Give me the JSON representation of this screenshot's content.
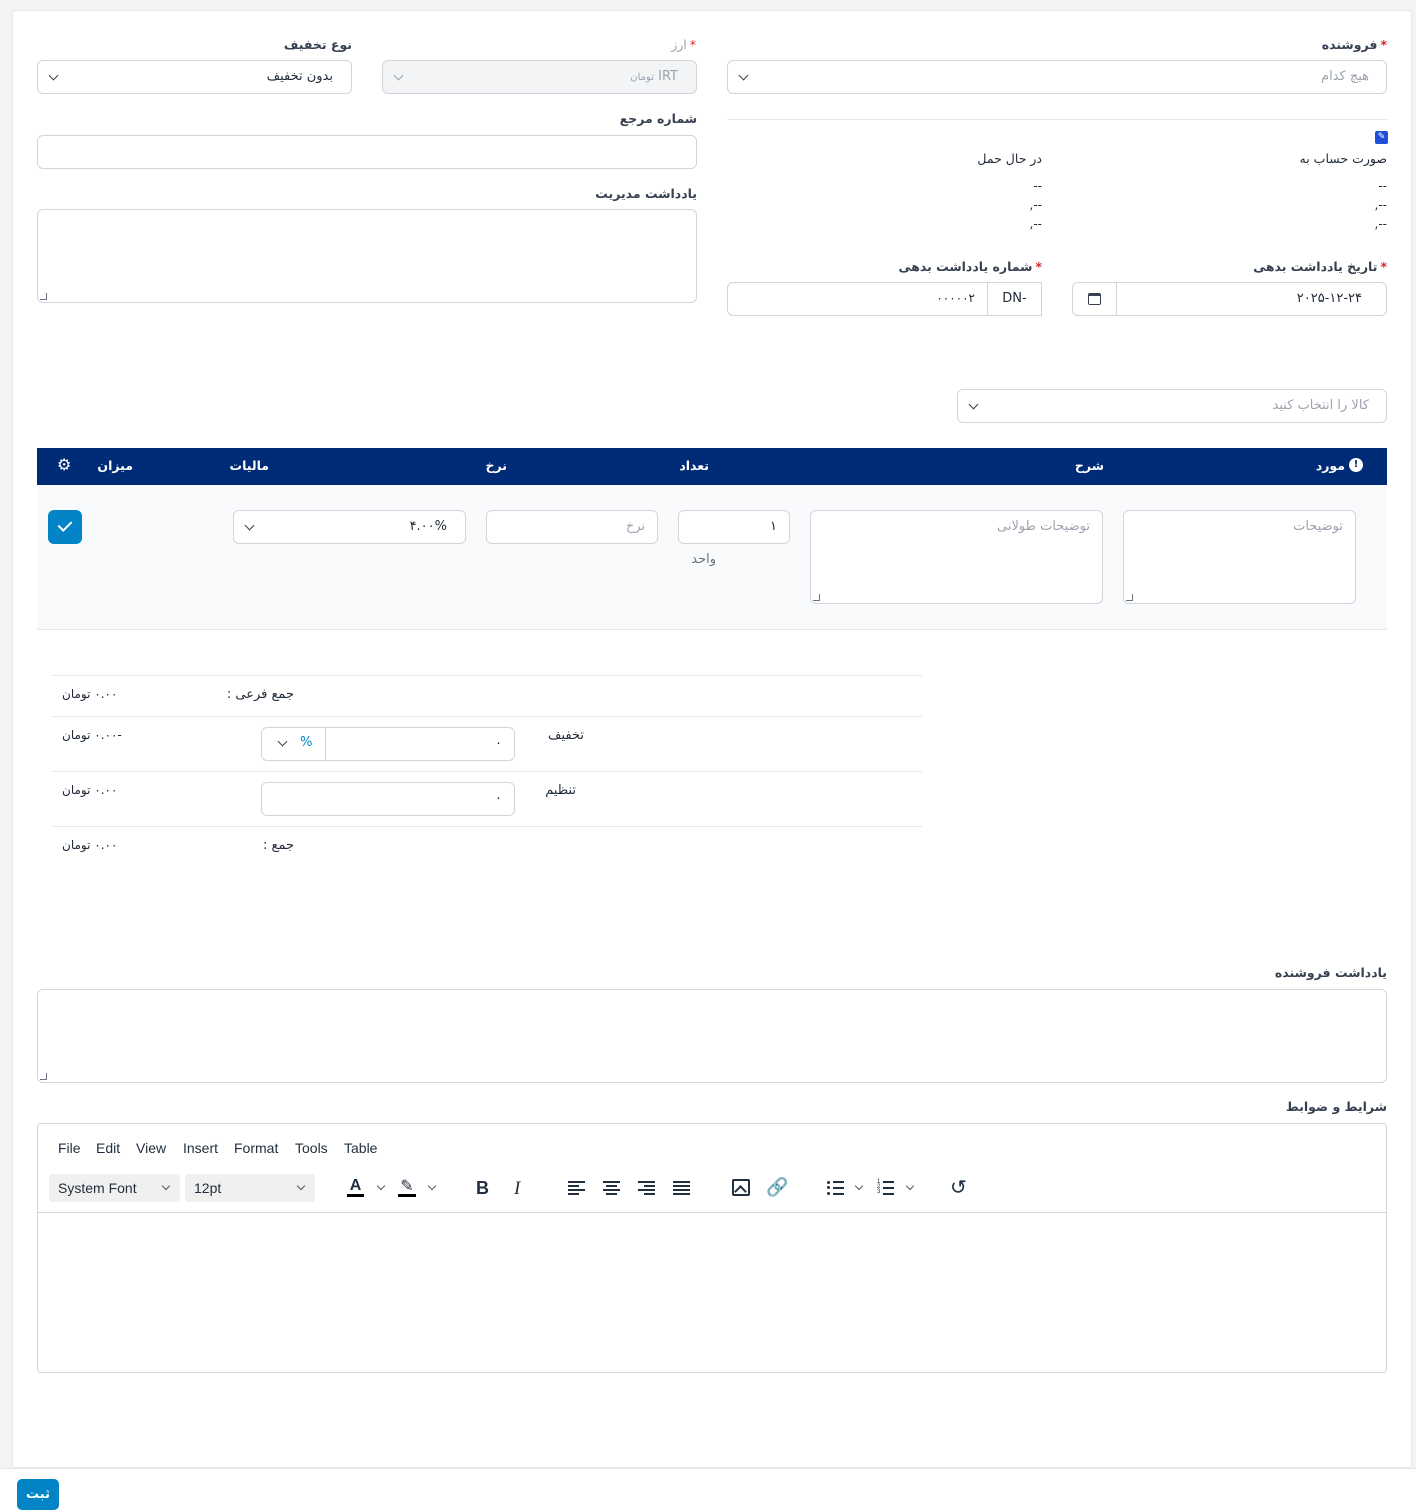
{
  "form": {
    "vendor_label": "فروشنده",
    "vendor_placeholder": "هیچ کدام",
    "currency_label": "ارز",
    "currency_value": "IRT",
    "currency_sub": "تومان",
    "discount_type_label": "نوع تخفیف",
    "discount_type_value": "بدون تخفیف",
    "reference_label": "شماره مرجع",
    "admin_note_label": "یادداشت مدیریت",
    "bill_to_label": "صورت حساب به",
    "ship_to_label": "در حال حمل",
    "bill_lines": [
      "--",
      "--,",
      "--,"
    ],
    "ship_lines": [
      "--",
      "--,",
      "--,"
    ],
    "debit_date_label": "تاریخ یادداشت بدهی",
    "debit_date_value": "۲۰۲۵-۱۲-۲۴",
    "debit_number_label": "شماره یادداشت بدهی",
    "debit_prefix": "DN-",
    "debit_number_value": "۰۰۰۰۰۲",
    "item_select_placeholder": "کالا را انتخاب کنید"
  },
  "table": {
    "headers": {
      "item": "مورد",
      "description": "شرح",
      "qty": "تعداد",
      "rate": "نرخ",
      "tax": "مالیات",
      "amount": "میزان"
    },
    "row": {
      "item_placeholder": "توضیحات",
      "long_desc_placeholder": "توضیحات طولانی",
      "qty_value": "۱",
      "unit_label": "واحد",
      "rate_placeholder": "نرخ",
      "tax_value": "۴.۰۰%"
    }
  },
  "totals": {
    "subtotal_label": "جمع فرعی :",
    "subtotal_value": "۰.۰۰ تومان",
    "discount_label": "تخفیف",
    "discount_input": "۰",
    "discount_unit": "%",
    "discount_value": "-۰.۰۰ تومان",
    "adjust_label": "تنظیم",
    "adjust_input": "۰",
    "adjust_value": "۰.۰۰ تومان",
    "total_label": "جمع :",
    "total_value": "۰.۰۰ تومان"
  },
  "vendor_note_label": "یادداشت فروشنده",
  "terms_label": "شرایط و ضوابط",
  "editor": {
    "menus": [
      "File",
      "Edit",
      "View",
      "Insert",
      "Format",
      "Tools",
      "Table"
    ],
    "font_family": "System Font",
    "font_size": "12pt"
  },
  "submit_label": "ثبت",
  "colors": {
    "header_bg": "#002b76",
    "primary": "#0284c7",
    "required": "#dc2626"
  }
}
